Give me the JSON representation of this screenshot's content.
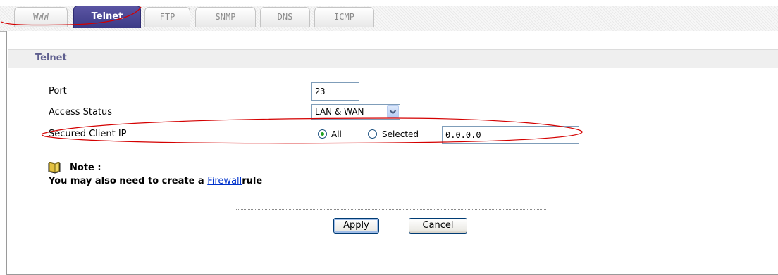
{
  "tabs": [
    {
      "label": "WWW",
      "active": false
    },
    {
      "label": "Telnet",
      "active": true
    },
    {
      "label": "FTP",
      "active": false
    },
    {
      "label": "SNMP",
      "active": false
    },
    {
      "label": "DNS",
      "active": false
    },
    {
      "label": "ICMP",
      "active": false
    }
  ],
  "section": {
    "title": "Telnet"
  },
  "form": {
    "port": {
      "label": "Port",
      "value": "23"
    },
    "access_status": {
      "label": "Access Status",
      "selected": "LAN & WAN"
    },
    "secured_client_ip": {
      "label": "Secured Client IP",
      "option_all": "All",
      "option_selected": "Selected",
      "checked": "All",
      "ip_value": "0.0.0.0"
    }
  },
  "note": {
    "heading": "Note :",
    "text_before": "You may also need to create a ",
    "link": "Firewall",
    "text_after": "rule"
  },
  "buttons": {
    "apply": "Apply",
    "cancel": "Cancel"
  },
  "colors": {
    "active_tab": "#3c3a86",
    "section_title": "#5e5e8e",
    "link": "#0033cc",
    "annotation": "#d40000"
  }
}
